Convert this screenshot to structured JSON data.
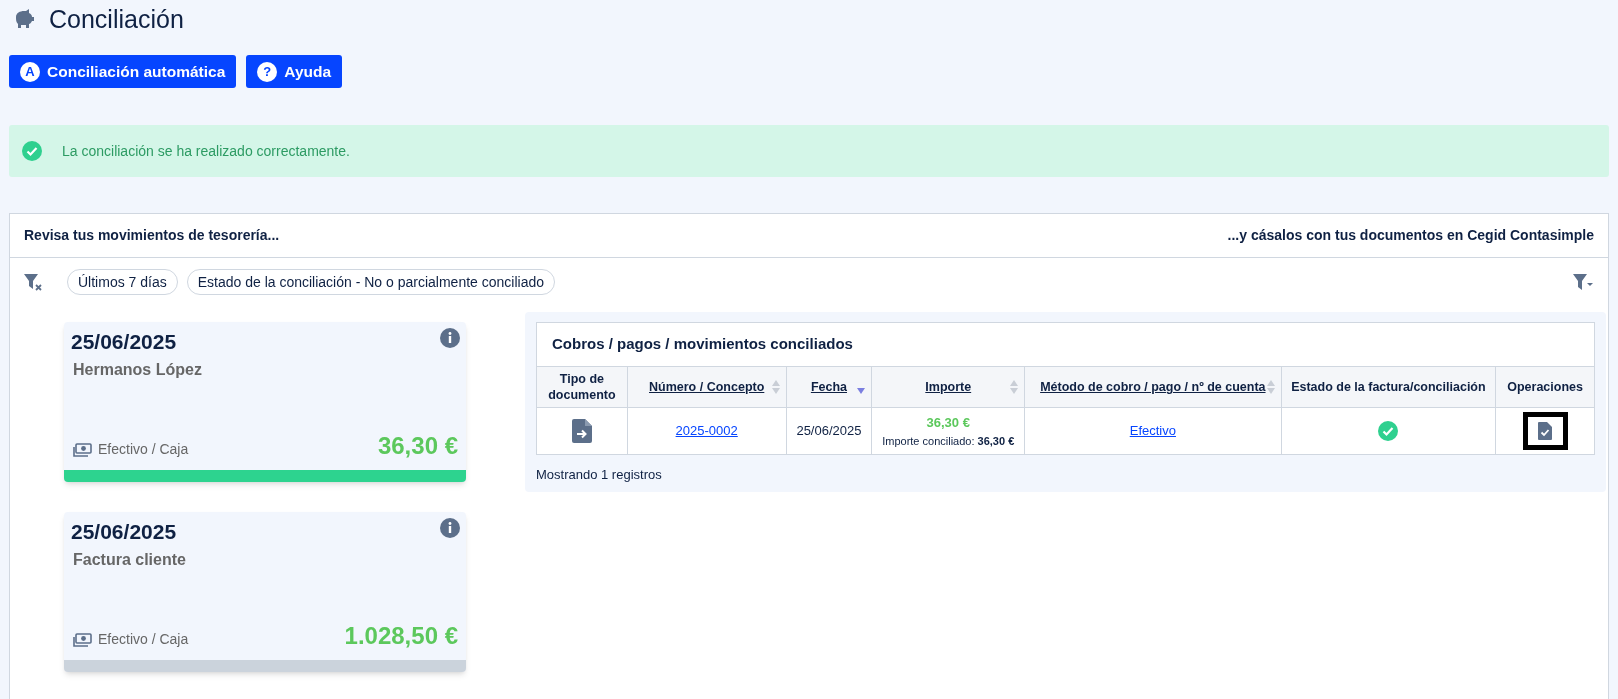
{
  "page_title": "Conciliación",
  "buttons": [
    {
      "icon_letter": "A",
      "label": "Conciliación automática"
    },
    {
      "icon_letter": "?",
      "label": "Ayuda"
    }
  ],
  "alert": {
    "kind": "success",
    "text": "La conciliación se ha realizado correctamente."
  },
  "panel": {
    "left_heading": "Revisa tus movimientos de tesorería...",
    "right_heading": "...y cásalos con tus documentos en Cegid Contasimple",
    "filters": [
      "Últimos 7 días",
      "Estado de la conciliación - No o parcialmente conciliado"
    ],
    "movements": [
      {
        "date": "25/06/2025",
        "name": "Hermanos López",
        "method": "Efectivo / Caja",
        "amount": "36,30 €",
        "selected": true
      },
      {
        "date": "25/06/2025",
        "name": "Factura cliente",
        "method": "Efectivo / Caja",
        "amount": "1.028,50 €",
        "selected": false
      }
    ],
    "table": {
      "title": "Cobros / pagos / movimientos conciliados",
      "columns": [
        {
          "label": "Tipo de documento",
          "sortable": false,
          "sorted_descending": false
        },
        {
          "label": "Número / Concepto",
          "sortable": true,
          "sorted_descending": false
        },
        {
          "label": "Fecha",
          "sortable": true,
          "sorted_descending": true
        },
        {
          "label": "Importe",
          "sortable": true,
          "sorted_descending": false
        },
        {
          "label": "Método de cobro / pago / nº de cuenta",
          "sortable": true,
          "sorted_descending": false
        },
        {
          "label": "Estado de la factura/conciliación",
          "sortable": false,
          "sorted_descending": false
        },
        {
          "label": "Operaciones",
          "sortable": false,
          "sorted_descending": false
        }
      ],
      "rows": [
        {
          "number": "2025-0002",
          "date": "25/06/2025",
          "amount": "36,30 €",
          "reconciled_label": "Importe conciliado:",
          "reconciled_amount": "36,30 €",
          "method": "Efectivo",
          "reconciled": true,
          "operation_focused": true
        }
      ],
      "footer": "Mostrando 1 registros"
    }
  }
}
